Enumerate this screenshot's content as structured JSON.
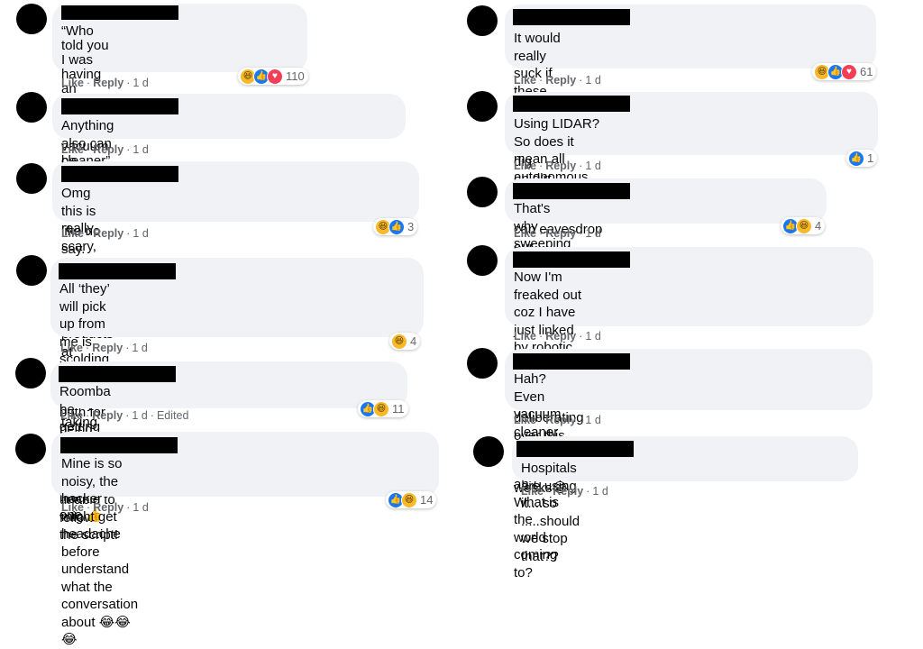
{
  "actions": {
    "like": "Like",
    "reply": "Reply",
    "time": "1 d",
    "edited": "Edited"
  },
  "colors": {
    "bubble": "#f0f2f5",
    "meta": "#65676b",
    "like_blue": "#1877f2",
    "love_red": "#f33e58",
    "haha_yellow": "#f7b928"
  },
  "left": [
    {
      "lines": "“Who told you I was having an affair?”\n\n“Your vacuum cleaner”",
      "reactions": [
        "haha",
        "like",
        "love"
      ],
      "count": "110"
    },
    {
      "lines": "Anything also can be spying on you la. Say like no say.",
      "reactions": [],
      "count": ""
    },
    {
      "lines": "Omg this is really scary, and I use alot of Xiaomi\nproducts at home.. China really taking over the world?",
      "reactions": [
        "haha",
        "like"
      ],
      "count": "3"
    },
    {
      "lines": "All ‘they’ will pick up from me is scolding of the iRobot,\nboth for being somewhat stupid and unable to follow\nthe script!",
      "reactions": [
        "haha"
      ],
      "count": "4"
    },
    {
      "lines": "Roomba be getting the dirt in more ways than one 👍",
      "reactions": [
        "like",
        "haha"
      ],
      "count": "11",
      "edited": true
    },
    {
      "lines": "Mine is so noisy, the hacker might get headache before\nunderstand what the conversation about 😂😂😂",
      "reactions": [
        "like",
        "haha"
      ],
      "count": "14"
    }
  ],
  "right": [
    {
      "lines": "It would really suck if these vacuum cleaners could dig\nup dirt on their owners.",
      "reactions": [
        "haha",
        "like",
        "love"
      ],
      "count": "61"
    },
    {
      "lines": "Using LIDAR? So does it mean all autonomous vehicles\nin the future can eavesdrop our conversations? 😱😱😱",
      "reactions": [
        "like"
      ],
      "count": "1"
    },
    {
      "lines": "That's why sweeping with a broom is still better",
      "reactions": [
        "like",
        "haha"
      ],
      "count": "4"
    },
    {
      "lines": "Now I'm freaked out coz I have just linked by robotic\ncleaner to my network after deliberating over this\ndecision for over two weeks😂",
      "reactions": [],
      "count": ""
    },
    {
      "lines": "Hah? Even vacuum cleaner can be a spy ah? What is\nthe world coming to?",
      "reactions": [],
      "count": ""
    },
    {
      "lines": "Hospitals are using it....so .....should we stop that??",
      "reactions": [],
      "count": ""
    }
  ]
}
